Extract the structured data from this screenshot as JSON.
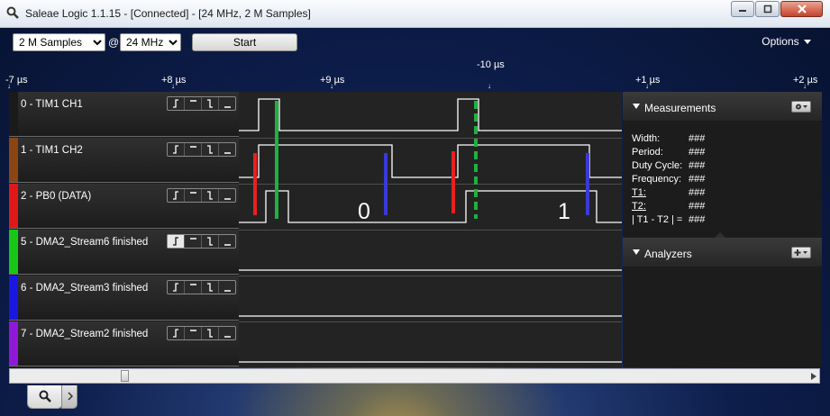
{
  "window": {
    "title": "Saleae Logic 1.1.15 - [Connected] - [24 MHz, 2 M Samples]",
    "icon": "magnifier-icon",
    "controls": [
      "minimize-icon",
      "maximize-icon",
      "close-icon"
    ]
  },
  "toolbar": {
    "samples": {
      "value": "2 M Samples",
      "options": [
        "2 M Samples"
      ]
    },
    "at_label": "@",
    "rate": {
      "value": "24 MHz",
      "options": [
        "24 MHz"
      ]
    },
    "start_label": "Start",
    "options_label": "Options"
  },
  "time_axis": {
    "labels": [
      "-7 µs",
      "+8 µs",
      "+9 µs",
      "-10 µs",
      "+1 µs",
      "+2 µs"
    ]
  },
  "channels": [
    {
      "label": "0 - TIM1 CH1",
      "color": "#1a1a1a"
    },
    {
      "label": "1 - TIM1 CH2",
      "color": "#8b4513"
    },
    {
      "label": "2 - PB0 (DATA)",
      "color": "#e01818"
    },
    {
      "label": "5 - DMA2_Stream6 finished",
      "color": "#18c818"
    },
    {
      "label": "6 - DMA2_Stream3 finished",
      "color": "#1818e0"
    },
    {
      "label": "7 - DMA2_Stream2 finished",
      "color": "#9018d8"
    }
  ],
  "trigger_icons": [
    "rising-edge-icon",
    "high-level-icon",
    "falling-edge-icon",
    "low-level-icon"
  ],
  "waveform": {
    "annotations": [
      "0",
      "1"
    ],
    "marker_colors": {
      "red": "#e82020",
      "green": "#20b040",
      "blue": "#3a3ad8"
    }
  },
  "measurements": {
    "title": "Measurements",
    "rows": [
      {
        "label": "Width:",
        "value": "###"
      },
      {
        "label": "Period:",
        "value": "###"
      },
      {
        "label": "Duty Cycle:",
        "value": "###"
      },
      {
        "label": "Frequency:",
        "value": "###"
      },
      {
        "label": "T1:",
        "value": "###"
      },
      {
        "label": "T2:",
        "value": "###"
      },
      {
        "label": "| T1 - T2 | =",
        "value": "###"
      }
    ]
  },
  "analyzers": {
    "title": "Analyzers"
  },
  "bottom_tabs": [
    "search-icon",
    "chevron-right-icon"
  ]
}
